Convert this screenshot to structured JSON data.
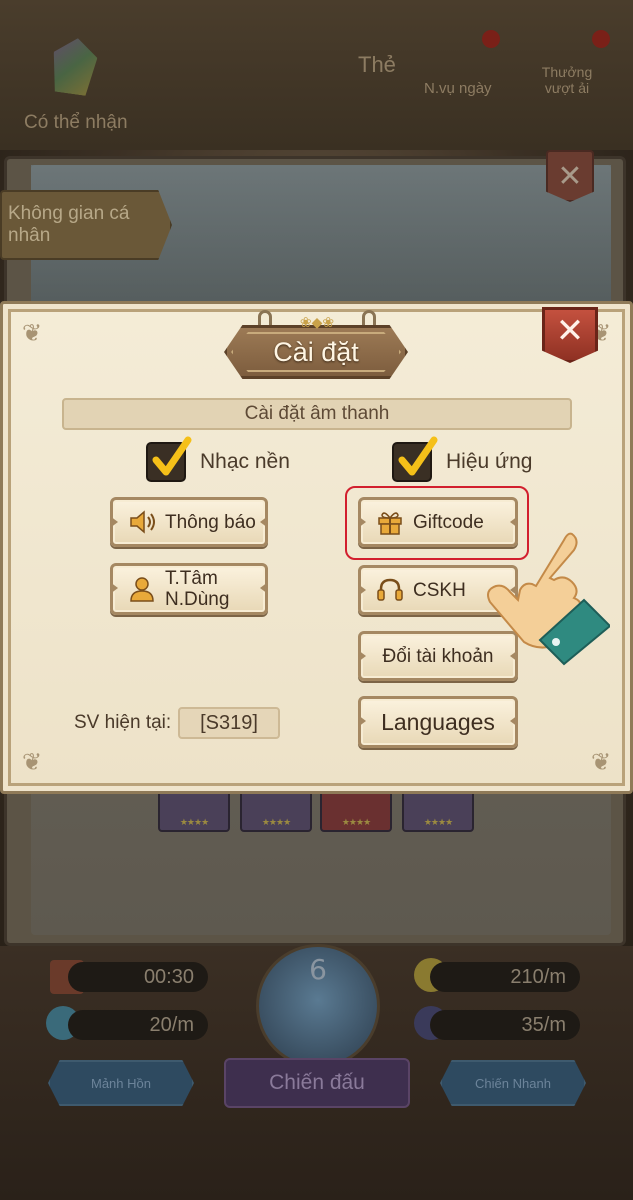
{
  "background": {
    "top_left_label": "Có thể nhận",
    "top_right_items": [
      {
        "label": "Thẻ"
      },
      {
        "label": "N.vụ ngày"
      },
      {
        "label": "Thưởng vượt ải"
      }
    ],
    "back_panel_tag": "Không gian cá nhân",
    "resources": {
      "timer": "00:30",
      "rate_gold": "210/m",
      "rate_blue": "20/m",
      "rate_moon": "35/m"
    },
    "orb_number": "6",
    "nav": {
      "left": "Mảnh Hồn",
      "center": "Chiến đấu",
      "right": "Chiến Nhanh"
    }
  },
  "dialog": {
    "title": "Cài đặt",
    "sound_section": "Cài đặt âm thanh",
    "checkbox_music": {
      "label": "Nhạc nền",
      "checked": true
    },
    "checkbox_effects": {
      "label": "Hiệu ứng",
      "checked": true
    },
    "buttons": {
      "notifications": "Thông báo",
      "user_center_line1": "T.Tâm",
      "user_center_line2": "N.Dùng",
      "giftcode": "Giftcode",
      "support": "CSKH",
      "switch_account": "Đổi tài khoản",
      "languages": "Languages"
    },
    "server_label": "SV hiện tại:",
    "server_value": "[S319]"
  },
  "colors": {
    "dialog_bg": "#f4ecd7",
    "title_plate": "#8d6a47",
    "close_red": "#b0402f",
    "highlight_red": "#d21f2e",
    "hand_skin": "#f4cf98",
    "hand_cuff": "#2f8a80"
  },
  "icons": {
    "checkbox": "checkmark-icon",
    "notifications": "speaker-icon",
    "user_center": "user-icon",
    "giftcode": "gift-icon",
    "support": "headset-icon",
    "close": "close-icon",
    "pointer": "pointing-hand-icon"
  }
}
